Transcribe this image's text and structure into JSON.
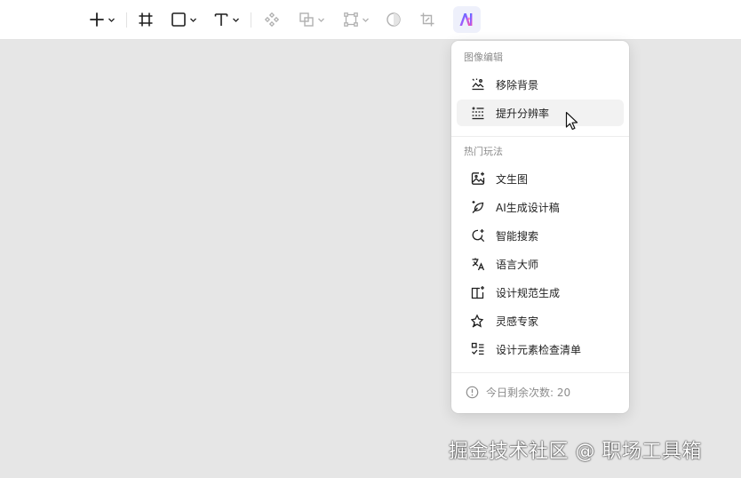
{
  "toolbar": {
    "tools": [
      {
        "icon": "plus-icon"
      },
      {
        "icon": "frame-icon"
      },
      {
        "icon": "rectangle-icon"
      },
      {
        "icon": "text-icon"
      },
      {
        "icon": "component-icon"
      },
      {
        "icon": "boolean-icon"
      },
      {
        "icon": "vector-edit-icon"
      },
      {
        "icon": "mask-icon"
      },
      {
        "icon": "crop-icon"
      },
      {
        "icon": "ai-logo-icon"
      }
    ]
  },
  "menu": {
    "sections": [
      {
        "title": "图像编辑",
        "items": [
          {
            "label": "移除背景",
            "icon": "remove-background-icon"
          },
          {
            "label": "提升分辨率",
            "icon": "upscale-icon",
            "hovered": true
          }
        ]
      },
      {
        "title": "热门玩法",
        "items": [
          {
            "label": "文生图",
            "icon": "image-sparkle-icon"
          },
          {
            "label": "AI生成设计稿",
            "icon": "leaf-pen-icon"
          },
          {
            "label": "智能搜索",
            "icon": "smart-search-icon"
          },
          {
            "label": "语言大师",
            "icon": "translate-icon"
          },
          {
            "label": "设计规范生成",
            "icon": "book-sparkle-icon"
          },
          {
            "label": "灵感专家",
            "icon": "pin-sparkle-icon"
          },
          {
            "label": "设计元素检查清单",
            "icon": "checklist-icon"
          }
        ]
      }
    ],
    "footer": {
      "label": "今日剩余次数: 20",
      "icon": "info-circle-icon"
    }
  },
  "watermark": "掘金技术社区 @ 职场工具箱",
  "colors": {
    "canvas": "#e6e6e6",
    "menu_bg": "#ffffff",
    "hover": "#f2f2f2",
    "muted_text": "#8c8c8c"
  }
}
